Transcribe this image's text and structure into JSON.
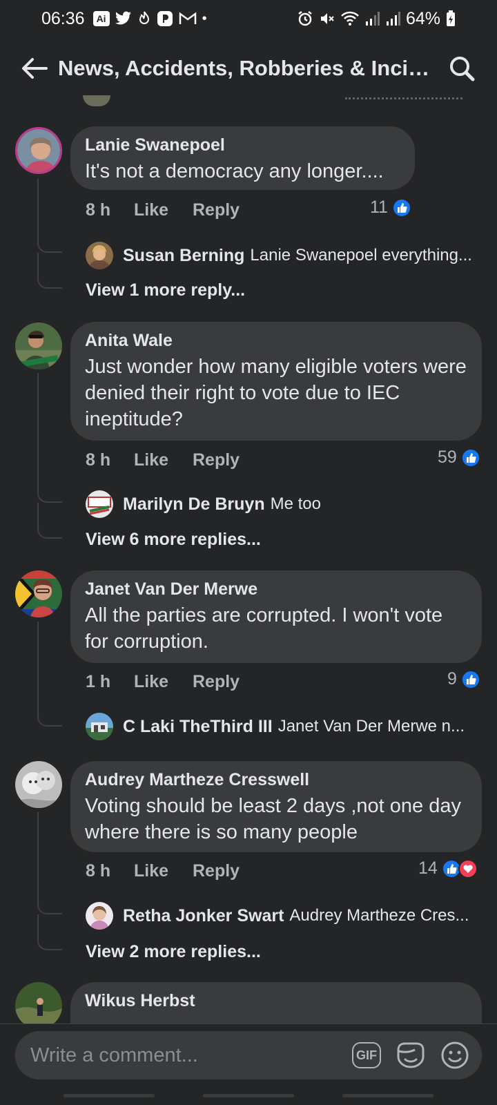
{
  "status_bar": {
    "time": "06:36",
    "battery": "64%",
    "left_icons": [
      "ai-badge-icon",
      "twitter-icon",
      "fire-icon",
      "paytm-icon",
      "gmail-icon",
      "dot-icon"
    ],
    "right_icons": [
      "alarm-icon",
      "mute-icon",
      "wifi-icon",
      "signal-icon",
      "signal-icon",
      "battery-icon"
    ],
    "ai_badge": "Ai"
  },
  "header": {
    "title": "News, Accidents, Robberies & Incid..."
  },
  "comments": [
    {
      "name": "Lanie Swanepoel",
      "text": "It's not a democracy any longer....",
      "time": "8 h",
      "like_label": "Like",
      "reply_label": "Reply",
      "reaction_count": "11",
      "reactions": [
        "like"
      ],
      "avatar_colors": [
        "#b83e8b",
        "#7b8fa3"
      ],
      "reply_preview": {
        "name": "Susan Berning",
        "text": "Lanie Swanepoel  everything..."
      },
      "view_more": "View 1 more reply..."
    },
    {
      "name": "Anita Wale",
      "text": "Just wonder how many eligible voters were denied their right to vote due to IEC ineptitude?",
      "time": "8 h",
      "like_label": "Like",
      "reply_label": "Reply",
      "reaction_count": "59",
      "reactions": [
        "like"
      ],
      "avatar_colors": [
        "#3e5a3a",
        "#6e7e55"
      ],
      "reply_preview": {
        "name": "Marilyn De Bruyn",
        "text": "Me too"
      },
      "view_more": "View 6 more replies..."
    },
    {
      "name": "Janet Van Der Merwe",
      "text": "All the parties are corrupted. I won't vote for corruption.",
      "time": "1 h",
      "like_label": "Like",
      "reply_label": "Reply",
      "reaction_count": "9",
      "reactions": [
        "like"
      ],
      "avatar_colors": [
        "#2d6b3a",
        "#c8423a"
      ],
      "reply_preview": {
        "name": "C Laki TheThird III",
        "text": "Janet Van Der Merwe  n..."
      },
      "view_more": ""
    },
    {
      "name": "Audrey Martheze Cresswell",
      "text": "Voting should be least 2 days ,not one day where there is so many people",
      "time": "8 h",
      "like_label": "Like",
      "reply_label": "Reply",
      "reaction_count": "14",
      "reactions": [
        "like",
        "love"
      ],
      "avatar_colors": [
        "#cfcfcf",
        "#9a9a9a"
      ],
      "reply_preview": {
        "name": "Retha Jonker Swart",
        "text": "Audrey Martheze Cres..."
      },
      "view_more": "View 2 more replies..."
    },
    {
      "name": "Wikus Herbst",
      "text": "",
      "avatar_colors": [
        "#3d5a2e",
        "#6d7a4a"
      ]
    }
  ],
  "composer": {
    "placeholder": "Write a comment...",
    "gif_label": "GIF"
  },
  "colors": {
    "background": "#242526",
    "bubble": "#3a3b3c",
    "primary_text": "#e4e6eb",
    "secondary_text": "#b0b3b8",
    "like_blue": "#1877f2",
    "love_red": "#f33e58"
  }
}
